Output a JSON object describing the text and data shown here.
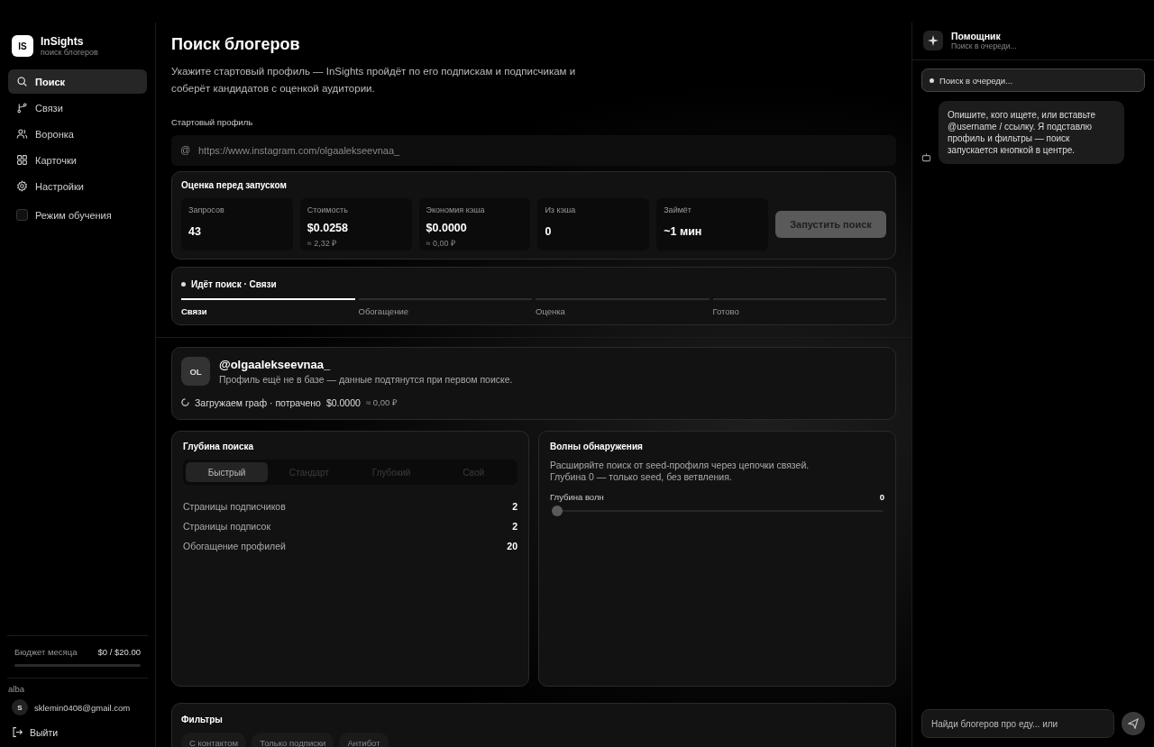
{
  "brand": {
    "logo": "IS",
    "name": "InSights",
    "subtitle": "поиск блогеров"
  },
  "nav": [
    {
      "label": "Поиск",
      "selected": true
    },
    {
      "label": "Связи",
      "selected": false
    },
    {
      "label": "Воронка",
      "selected": false
    },
    {
      "label": "Карточки",
      "selected": false
    },
    {
      "label": "Настройки",
      "selected": false
    }
  ],
  "learning_mode": {
    "label": "Режим обучения",
    "checked": false
  },
  "budget": {
    "label": "Бюджет месяца",
    "value": "$0 / $20.00",
    "level": 0
  },
  "account": {
    "workspace": "alba",
    "avatar": "S",
    "email": "sklemin0408@gmail.com",
    "logout": "Выйти"
  },
  "page": {
    "title": "Поиск блогеров",
    "description": "Укажите стартовый профиль — InSights пройдёт по его подпискам и подписчикам и соберёт кандидатов с оценкой аудитории.",
    "start_label": "Стартовый профиль",
    "start_prefix": "@",
    "start_value": "https://www.instagram.com/olgaalekseevnaa_"
  },
  "estimate": {
    "title": "Оценка перед запуском",
    "stats": [
      {
        "label": "Запросов",
        "value": "43"
      },
      {
        "label": "Стоимость",
        "value": "$0.0258",
        "sub": "≈ 2,32 ₽"
      },
      {
        "label": "Экономия кэша",
        "value": "$0.0000",
        "sub": "≈ 0,00 ₽"
      },
      {
        "label": "Из кэша",
        "value": "0"
      },
      {
        "label": "Займёт",
        "value": "~1 мин"
      }
    ],
    "button": "Запустить поиск"
  },
  "progress": {
    "status": "Идёт поиск · Связи",
    "stages": [
      {
        "label": "Связи",
        "active": true
      },
      {
        "label": "Обогащение",
        "active": false
      },
      {
        "label": "Оценка",
        "active": false
      },
      {
        "label": "Готово",
        "active": false
      }
    ]
  },
  "profile": {
    "avatar": "OL",
    "handle": "@olgaalekseevnaa_",
    "note": "Профиль ещё не в базе — данные подтянутся при первом поиске.",
    "status": "Загружаем граф · потрачено",
    "spent": "$0.0000",
    "spent_rub": "≈ 0,00 ₽"
  },
  "depth": {
    "title": "Глубина поиска",
    "options": [
      {
        "label": "Быстрый",
        "selected": true
      },
      {
        "label": "Стандарт",
        "selected": false
      },
      {
        "label": "Глубокий",
        "selected": false
      },
      {
        "label": "Свой",
        "selected": false
      }
    ],
    "rows": [
      {
        "label": "Страницы подписчиков",
        "value": "2"
      },
      {
        "label": "Страницы подписок",
        "value": "2"
      },
      {
        "label": "Обогащение профилей",
        "value": "20"
      }
    ]
  },
  "waves": {
    "title": "Волны обнаружения",
    "description": "Расширяйте поиск от seed-профиля через цепочки связей. Глубина 0 — только seed, без ветвления.",
    "slider_label": "Глубина волн",
    "slider_value": "0",
    "level": 0
  },
  "filters": {
    "title": "Фильтры",
    "chips": [
      {
        "label": "С контактом",
        "selected": false
      },
      {
        "label": "Только подписки",
        "selected": false
      },
      {
        "label": "Антибот",
        "selected": false
      }
    ]
  },
  "assistant": {
    "title": "Помощник",
    "subtitle": "Поиск в очереди...",
    "status": "Поиск в очереди...",
    "message": "Опишите, кого ищете, или вставьте @username / ссылку. Я подставлю профиль и фильтры — поиск запускается кнопкой в центре.",
    "input_placeholder": "Найди блогеров про еду... или"
  }
}
